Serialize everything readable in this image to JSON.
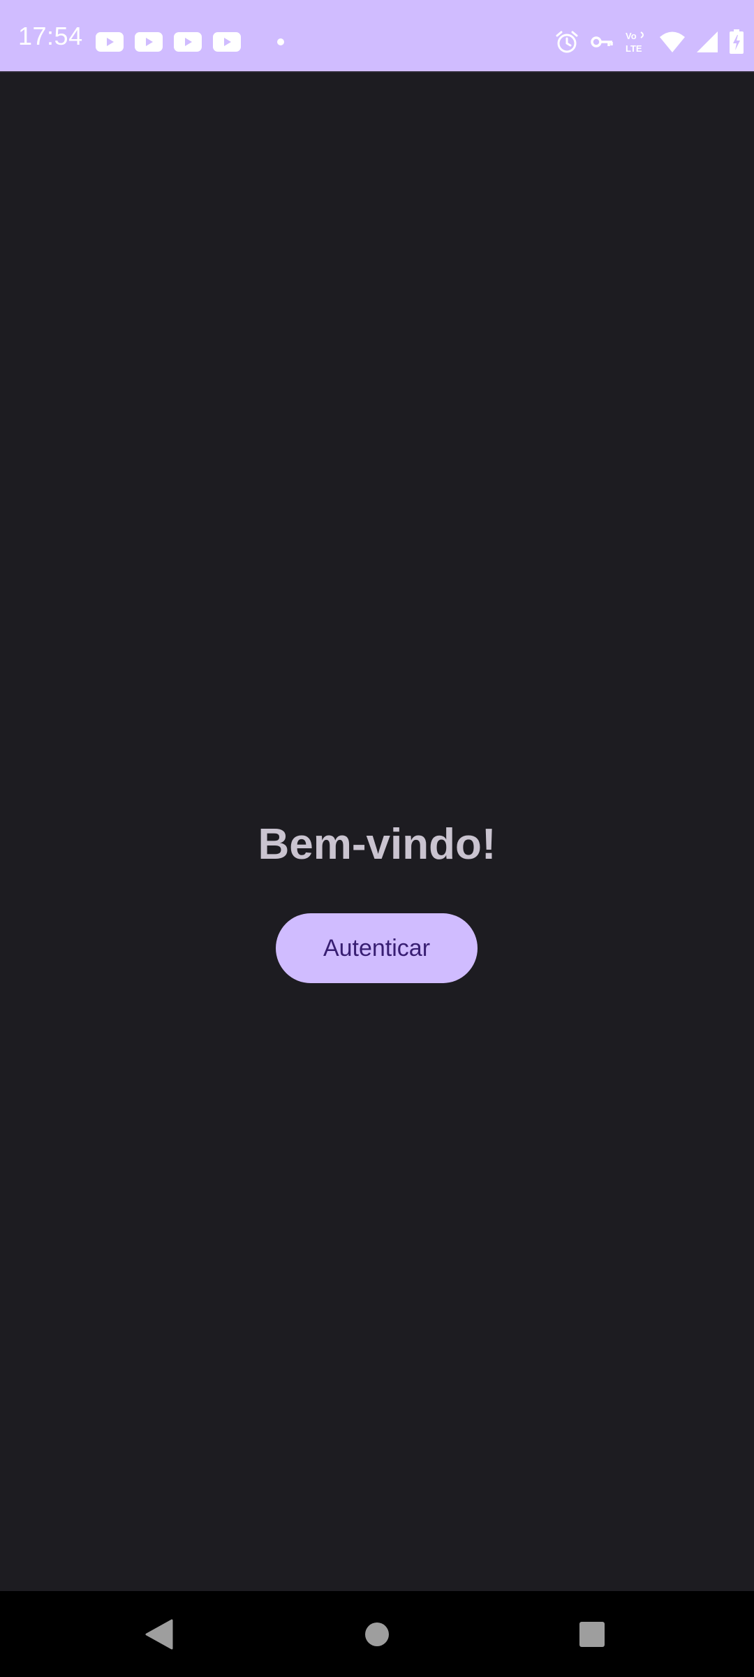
{
  "status_bar": {
    "time": "17:54",
    "background": "#d0bcff",
    "notification_icons": [
      "youtube-icon",
      "youtube-icon",
      "youtube-icon",
      "youtube-icon",
      "dot-icon"
    ],
    "system_icons": [
      "alarm-icon",
      "vpn-key-icon",
      "volte-icon",
      "wifi-icon",
      "signal-icon",
      "battery-charging-icon"
    ],
    "volte_label_top": "Vo",
    "volte_label_bottom": "LTE"
  },
  "main": {
    "background": "#1d1c21",
    "title": "Bem-vindo!",
    "button_label": "Autenticar",
    "accent": "#d0bcff",
    "button_text_color": "#381e72"
  },
  "nav_bar": {
    "buttons": [
      "back-icon",
      "home-icon",
      "recents-icon"
    ]
  }
}
